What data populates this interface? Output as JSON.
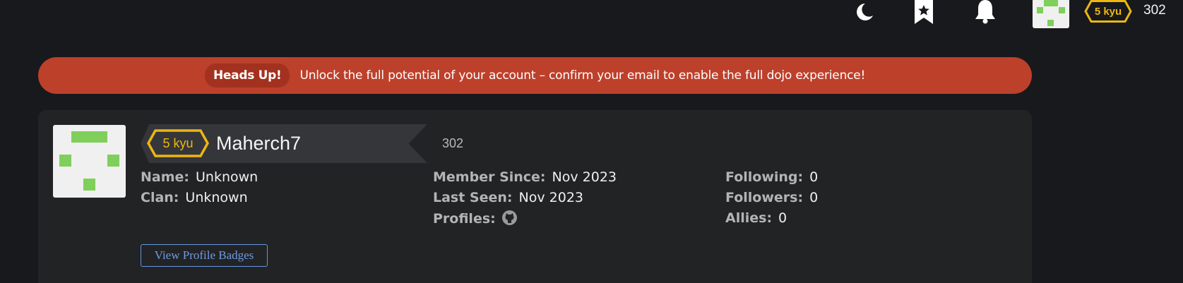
{
  "topbar": {
    "icons": [
      "moon-icon",
      "bookmark-star-icon",
      "bell-icon"
    ],
    "rank": "5 kyu",
    "honor": "302"
  },
  "alert": {
    "tag": "Heads Up!",
    "message": "Unlock the full potential of your account – confirm your email to enable the full dojo experience!"
  },
  "profile": {
    "rank": "5 kyu",
    "username": "Maherch7",
    "honor": "302",
    "stats": {
      "name": {
        "label": "Name:",
        "value": "Unknown"
      },
      "clan": {
        "label": "Clan:",
        "value": "Unknown"
      },
      "member_since": {
        "label": "Member Since:",
        "value": "Nov 2023"
      },
      "last_seen": {
        "label": "Last Seen:",
        "value": "Nov 2023"
      },
      "profiles": {
        "label": "Profiles:",
        "icons": [
          "github-icon"
        ]
      },
      "following": {
        "label": "Following:",
        "value": "0"
      },
      "followers": {
        "label": "Followers:",
        "value": "0"
      },
      "allies": {
        "label": "Allies:",
        "value": "0"
      }
    },
    "badges_button": "View Profile Badges"
  },
  "colors": {
    "background": "#18191c",
    "card": "#222325",
    "alert": "#bd402b",
    "rank_yellow": "#ecb613",
    "link_blue": "#6795de",
    "identicon_green": "#7fcf5a"
  }
}
